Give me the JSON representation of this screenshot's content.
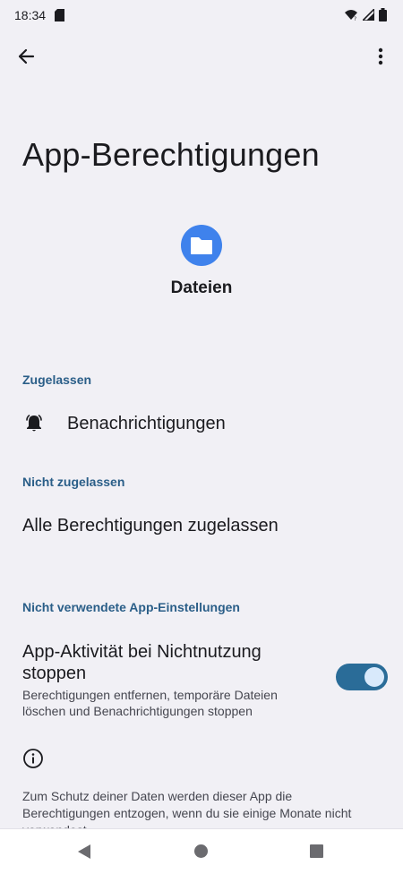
{
  "status_bar": {
    "time": "18:34",
    "icons": [
      "sim-card-icon",
      "wifi-icon",
      "signal-icon",
      "battery-icon"
    ]
  },
  "toolbar": {
    "back_icon": "arrow-back-icon",
    "more_icon": "more-vert-icon"
  },
  "page": {
    "title": "App-Berechtigungen",
    "app_name": "Dateien",
    "app_icon": "folder-icon"
  },
  "sections": {
    "allowed": {
      "header": "Zugelassen",
      "items": [
        {
          "label": "Benachrichtigungen",
          "icon": "notification-bell-icon"
        }
      ]
    },
    "not_allowed": {
      "header": "Nicht zugelassen",
      "items": [
        {
          "label": "Alle Berechtigungen zugelassen"
        }
      ]
    },
    "unused": {
      "header": "Nicht verwendete App-Einstellungen",
      "switch_title": "App-Aktivität bei Nichtnutzung stoppen",
      "switch_summary": "Berechtigungen entfernen, temporäre Dateien löschen und Benachrichtigungen stoppen",
      "switch_on": true
    }
  },
  "footer": {
    "info_icon": "info-icon",
    "text": "Zum Schutz deiner Daten werden dieser App die Berechtigungen entzogen, wenn du sie einige Monate nicht verwendest."
  },
  "colors": {
    "background": "#f1f0f5",
    "accent": "#2a5e88",
    "app_icon_bg": "#3f82ec",
    "switch_track": "#2a6c98"
  }
}
